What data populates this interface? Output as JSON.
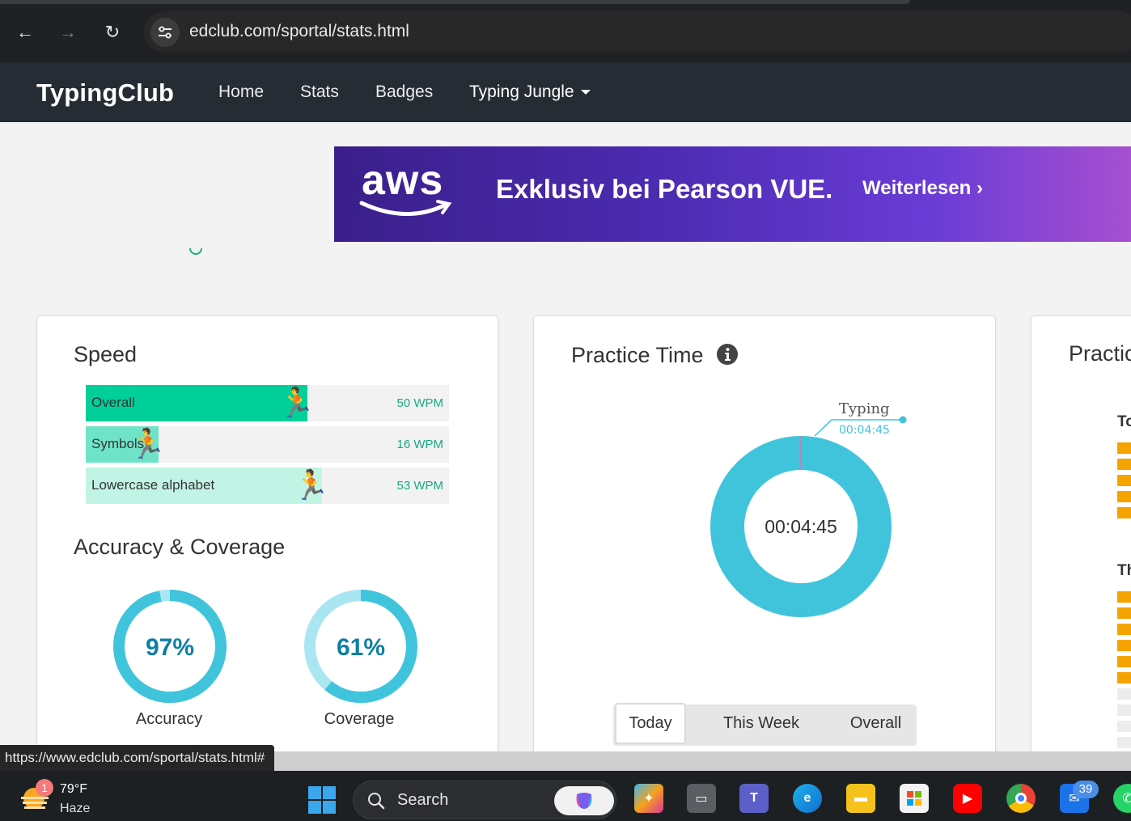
{
  "browser": {
    "url": "edclub.com/sportal/stats.html",
    "status_url": "https://www.edclub.com/sportal/stats.html#"
  },
  "site_nav": {
    "brand": "TypingClub",
    "links": [
      "Home",
      "Stats",
      "Badges",
      "Typing Jungle"
    ]
  },
  "ad": {
    "logo": "aws",
    "headline": "Exklusiv bei Pearson VUE.",
    "cta": "Weiterlesen ›"
  },
  "speed_card": {
    "title": "Speed",
    "rows": [
      {
        "label": "Overall",
        "value": "50 WPM",
        "fill": 0.61,
        "color": "#00cf9a"
      },
      {
        "label": "Symbols",
        "value": "16 WPM",
        "fill": 0.2,
        "color": "#6fe3c8"
      },
      {
        "label": "Lowercase alphabet",
        "value": "53 WPM",
        "fill": 0.65,
        "color": "#c2f4e6"
      }
    ],
    "accuracy_title": "Accuracy & Coverage",
    "accuracy": {
      "value": "97%",
      "label": "Accuracy",
      "fraction": 0.97
    },
    "coverage": {
      "value": "61%",
      "label": "Coverage",
      "fraction": 0.61
    }
  },
  "practice_card": {
    "title": "Practice Time",
    "center_time": "00:04:45",
    "legend_label": "Typing",
    "legend_time": "00:04:45",
    "tabs": [
      "Today",
      "This Week",
      "Overall"
    ],
    "active_tab": "Today"
  },
  "third_card": {
    "title": "Practic",
    "section1": "To",
    "section2": "Th"
  },
  "taskbar": {
    "temp": "79°F",
    "weather": "Haze",
    "weather_badge": "1",
    "search": "Search",
    "mail_badge": "39"
  },
  "colors": {
    "donut": "#40c4dc",
    "donut_light": "#a9e6f2",
    "ring_text": "#0e7fa3",
    "bar_orange": "#f5a300"
  }
}
